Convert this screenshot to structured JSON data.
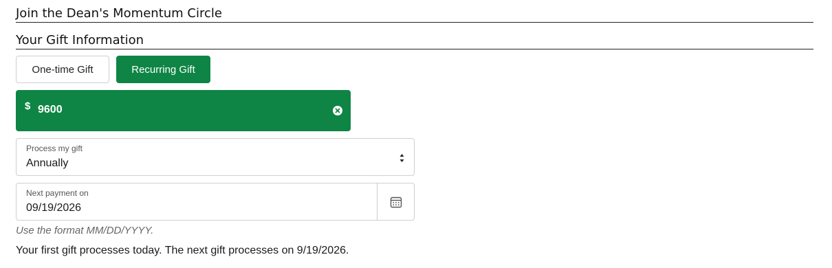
{
  "headings": {
    "title": "Join the Dean's Momentum Circle",
    "section": "Your Gift Information"
  },
  "gift_type": {
    "options": [
      "One-time Gift",
      "Recurring Gift"
    ],
    "selected": "Recurring Gift"
  },
  "amount": {
    "currency_symbol": "$",
    "value": "9600",
    "clear_icon": "clear-circle-x-icon"
  },
  "frequency": {
    "label": "Process my gift",
    "value": "Annually",
    "icon": "sort-arrows-icon"
  },
  "next_payment": {
    "label": "Next payment on",
    "value": "09/19/2026",
    "icon": "calendar-icon",
    "hint": "Use the format MM/DD/YYYY."
  },
  "note": "Your first gift processes today. The next gift processes on 9/19/2026.",
  "colors": {
    "accent": "#0e8545",
    "border": "#cfcfcf",
    "hint_text": "#666666"
  }
}
